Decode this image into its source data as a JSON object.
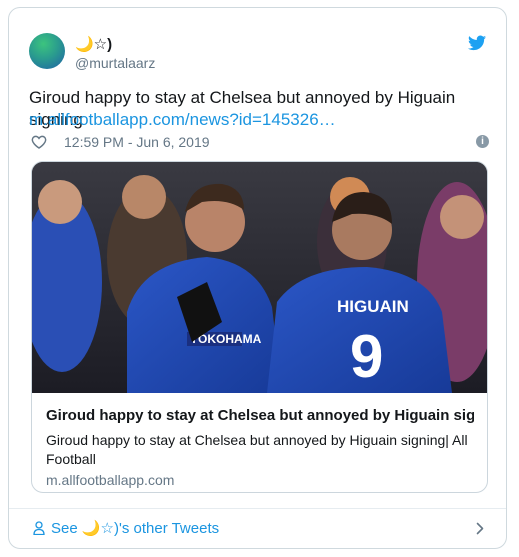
{
  "author": {
    "display_name": "🌙☆)",
    "handle": "@murtalaarz"
  },
  "tweet": {
    "text": "Giroud happy to stay at Chelsea but annoyed by Higuain signing",
    "link": "m.allfootballapp.com/news?id=145326…",
    "timestamp": "12:59 PM - Jun 6, 2019"
  },
  "card": {
    "image_shirt_sponsor": "YOKOHAMA",
    "image_shirt_name": "HIGUAIN",
    "image_shirt_number": "9",
    "title": "Giroud happy to stay at Chelsea but annoyed by Higuain signi…",
    "description": "Giroud happy to stay at Chelsea but annoyed by Higuain signing| All Football",
    "domain": "m.allfootballapp.com"
  },
  "footer": {
    "see_more_label": "See 🌙☆)'s other Tweets"
  },
  "colors": {
    "accent": "#1b95e0",
    "text": "#14171a",
    "muted": "#657786",
    "border": "#cfd9de"
  },
  "icons": [
    "twitter-bird-icon",
    "heart-icon",
    "info-icon",
    "person-icon",
    "chevron-right-icon"
  ]
}
